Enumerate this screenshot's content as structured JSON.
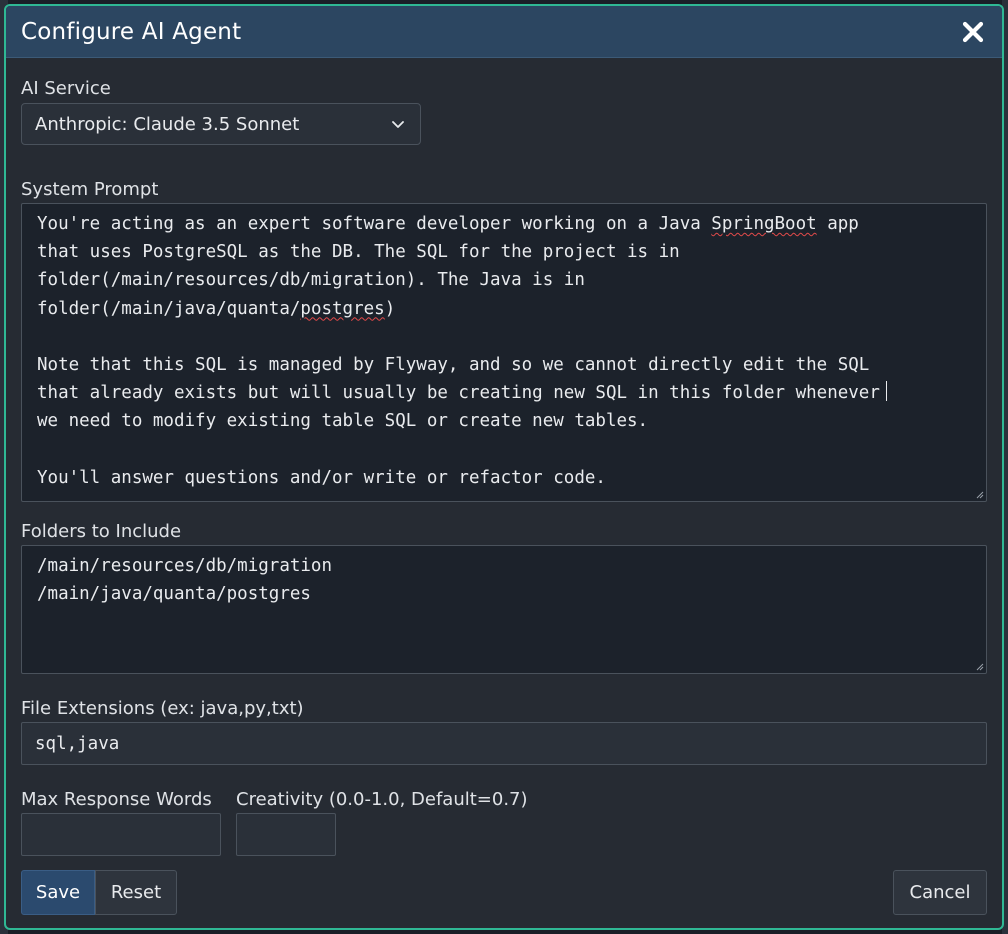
{
  "dialog": {
    "title": "Configure AI Agent"
  },
  "ai_service": {
    "label": "AI Service",
    "selected": "Anthropic: Claude 3.5 Sonnet"
  },
  "system_prompt": {
    "label": "System Prompt",
    "line1_a": "You're acting as an expert software developer working on a Java ",
    "line1_b": "SpringBoot",
    "line1_c": " app",
    "line2": "that uses PostgreSQL as the DB. The SQL for the project is in",
    "line3": "folder(/main/resources/db/migration). The Java is in",
    "line4_a": "folder(/main/java/quanta/",
    "line4_b": "postgres",
    "line4_c": ")",
    "line6": "Note that this SQL is managed by Flyway, and so we cannot directly edit the SQL",
    "line7": "that already exists but will usually be creating new SQL in this folder whenever",
    "line8": "we need to modify existing table SQL or create new tables.",
    "line10": "You'll answer questions and/or write or refactor code."
  },
  "folders": {
    "label": "Folders to Include",
    "line1": "/main/resources/db/migration",
    "line2": "/main/java/quanta/postgres"
  },
  "file_extensions": {
    "label": "File Extensions (ex: java,py,txt)",
    "value": "sql,java"
  },
  "max_response_words": {
    "label": "Max Response Words",
    "value": ""
  },
  "creativity": {
    "label": "Creativity (0.0-1.0, Default=0.7)",
    "value": ""
  },
  "buttons": {
    "save": "Save",
    "reset": "Reset",
    "cancel": "Cancel"
  },
  "colors": {
    "header_bg": "#2c4661",
    "dialog_border": "#2fb894",
    "save_button": "#2b4a6e",
    "spellcheck_underline": "#e24a4a"
  },
  "icons": {
    "close": "close-icon",
    "dropdown": "chevron-down-icon"
  }
}
